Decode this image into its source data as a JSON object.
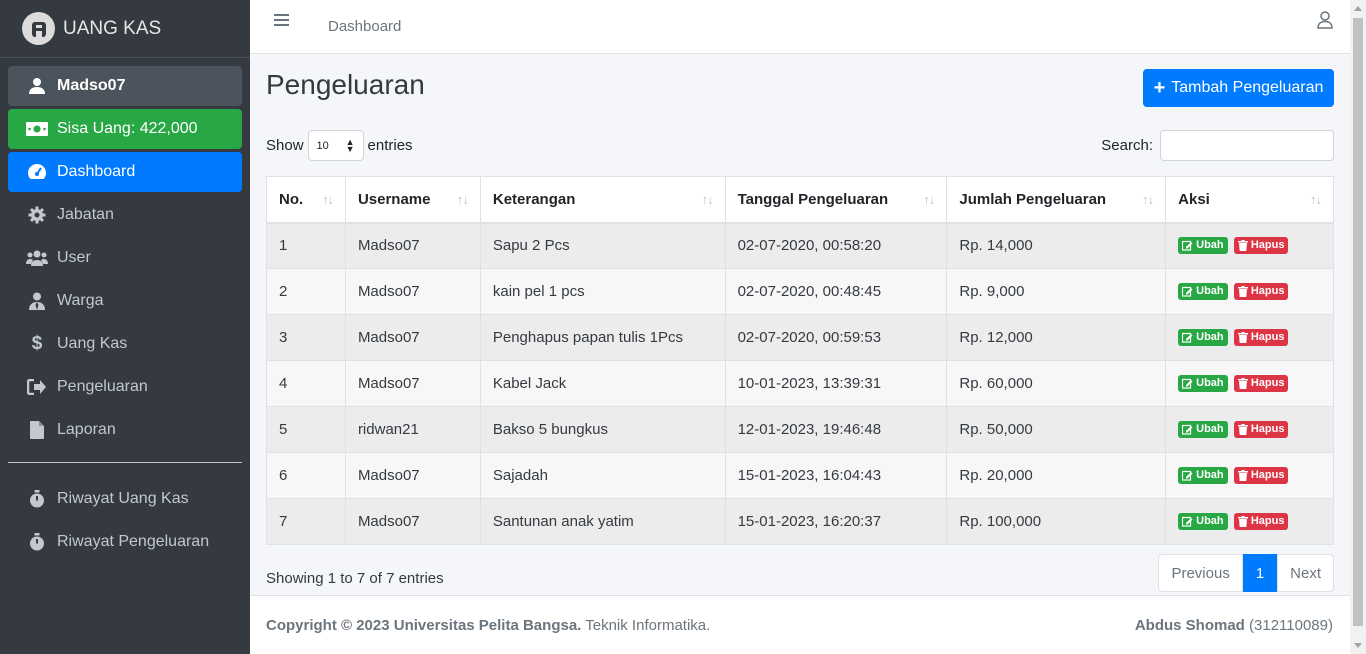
{
  "brand": {
    "name": "UANG KAS"
  },
  "sidebar": {
    "user": "Madso07",
    "balance": "Sisa Uang: 422,000",
    "items": [
      {
        "label": "Dashboard",
        "icon": "tachometer-icon"
      },
      {
        "label": "Jabatan",
        "icon": "gear-icon"
      },
      {
        "label": "User",
        "icon": "users-icon"
      },
      {
        "label": "Warga",
        "icon": "user-icon"
      },
      {
        "label": "Uang Kas",
        "icon": "dollar-icon"
      },
      {
        "label": "Pengeluaran",
        "icon": "sign-out-icon"
      },
      {
        "label": "Laporan",
        "icon": "file-icon"
      },
      {
        "label": "Riwayat Uang Kas",
        "icon": "stopwatch-icon"
      },
      {
        "label": "Riwayat Pengeluaran",
        "icon": "stopwatch-icon"
      }
    ]
  },
  "topbar": {
    "link": "Dashboard"
  },
  "page": {
    "title": "Pengeluaran",
    "add_button": "Tambah Pengeluaran",
    "show_label": "Show",
    "entries_label": "entries",
    "entries_value": "10",
    "search_label": "Search:",
    "search_value": ""
  },
  "table": {
    "headers": [
      "No.",
      "Username",
      "Keterangan",
      "Tanggal Pengeluaran",
      "Jumlah Pengeluaran",
      "Aksi"
    ],
    "edit_label": "Ubah",
    "delete_label": "Hapus",
    "rows": [
      {
        "no": "1",
        "username": "Madso07",
        "keterangan": "Sapu 2 Pcs",
        "tanggal": "02-07-2020, 00:58:20",
        "jumlah": "Rp. 14,000"
      },
      {
        "no": "2",
        "username": "Madso07",
        "keterangan": "kain pel 1 pcs",
        "tanggal": "02-07-2020, 00:48:45",
        "jumlah": "Rp. 9,000"
      },
      {
        "no": "3",
        "username": "Madso07",
        "keterangan": "Penghapus papan tulis 1Pcs",
        "tanggal": "02-07-2020, 00:59:53",
        "jumlah": "Rp. 12,000"
      },
      {
        "no": "4",
        "username": "Madso07",
        "keterangan": "Kabel Jack",
        "tanggal": "10-01-2023, 13:39:31",
        "jumlah": "Rp. 60,000"
      },
      {
        "no": "5",
        "username": "ridwan21",
        "keterangan": "Bakso 5 bungkus",
        "tanggal": "12-01-2023, 19:46:48",
        "jumlah": "Rp. 50,000"
      },
      {
        "no": "6",
        "username": "Madso07",
        "keterangan": "Sajadah",
        "tanggal": "15-01-2023, 16:04:43",
        "jumlah": "Rp. 20,000"
      },
      {
        "no": "7",
        "username": "Madso07",
        "keterangan": "Santunan anak yatim",
        "tanggal": "15-01-2023, 16:20:37",
        "jumlah": "Rp. 100,000"
      }
    ]
  },
  "pagination": {
    "info": "Showing 1 to 7 of 7 entries",
    "previous": "Previous",
    "current": "1",
    "next": "Next"
  },
  "footer": {
    "copyright": "Copyright © 2023 Universitas Pelita Bangsa.",
    "dept": "Teknik Informatika.",
    "author": "Abdus Shomad",
    "nim": "(312110089)"
  },
  "colors": {
    "sidebar": "#343a40",
    "primary": "#007bff",
    "success": "#28a745",
    "danger": "#dc3545"
  }
}
